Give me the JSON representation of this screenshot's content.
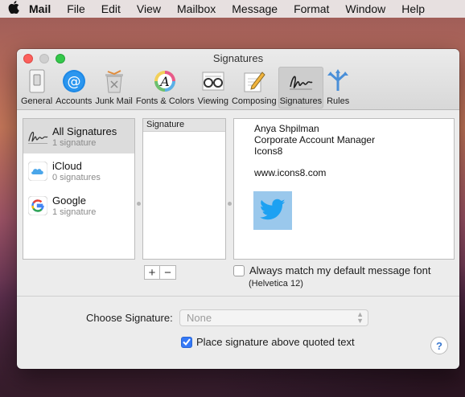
{
  "menubar": {
    "items": [
      "Mail",
      "File",
      "Edit",
      "View",
      "Mailbox",
      "Message",
      "Format",
      "Window",
      "Help"
    ]
  },
  "window": {
    "title": "Signatures"
  },
  "toolbar": {
    "items": [
      {
        "label": "General",
        "icon": "general-switch-icon"
      },
      {
        "label": "Accounts",
        "icon": "at-sign-icon"
      },
      {
        "label": "Junk Mail",
        "icon": "trash-icon"
      },
      {
        "label": "Fonts & Colors",
        "icon": "font-palette-icon"
      },
      {
        "label": "Viewing",
        "icon": "glasses-icon"
      },
      {
        "label": "Composing",
        "icon": "pencil-note-icon"
      },
      {
        "label": "Signatures",
        "icon": "signature-icon"
      },
      {
        "label": "Rules",
        "icon": "rules-icon"
      }
    ],
    "active": "Signatures"
  },
  "accounts": [
    {
      "name": "All Signatures",
      "count": "1 signature",
      "icon": "signature-icon"
    },
    {
      "name": "iCloud",
      "count": "0 signatures",
      "icon": "icloud-icon"
    },
    {
      "name": "Google",
      "count": "1 signature",
      "icon": "google-icon"
    }
  ],
  "signatures_list": {
    "header": "Signature"
  },
  "preview": {
    "lines": [
      "Anya Shpilman",
      "Corporate Account Manager",
      "Icons8",
      "www.icons8.com"
    ],
    "image_icon": "twitter-bird-icon"
  },
  "buttons": {
    "add": "+",
    "remove": "−"
  },
  "options": {
    "always_match_label": "Always match my default message font",
    "always_match_checked": false,
    "font_note": "(Helvetica 12)",
    "choose_label": "Choose Signature:",
    "choose_value": "None",
    "place_above_label": "Place signature above quoted text",
    "place_above_checked": true,
    "help": "?"
  },
  "colors": {
    "accent": "#3478f6",
    "twitter_bg": "#9ac8ec"
  }
}
